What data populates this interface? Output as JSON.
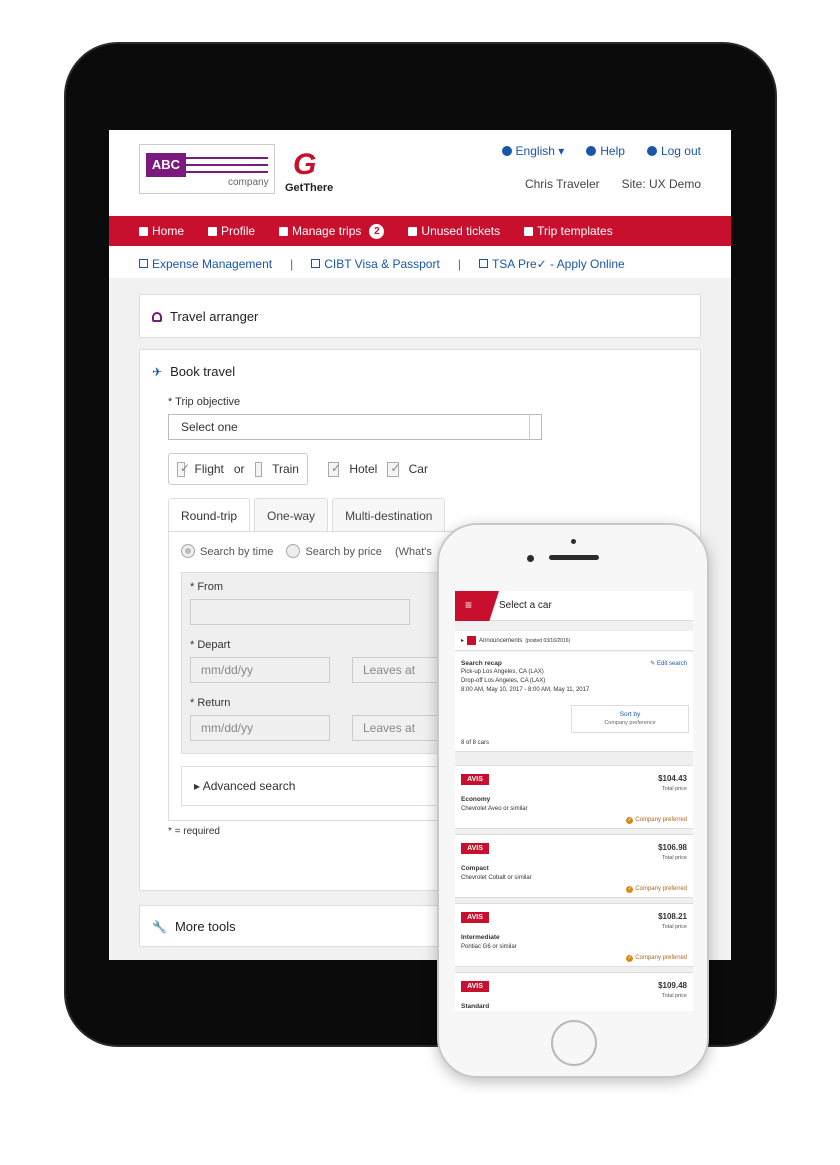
{
  "tablet": {
    "header": {
      "logo_abc": "ABC",
      "logo_company": "company",
      "logo_getthere_mark": "G",
      "logo_getthere": "GetThere",
      "language": "English",
      "help": "Help",
      "logout": "Log out",
      "user_name": "Chris Traveler",
      "site": "Site: UX Demo"
    },
    "nav": {
      "items": [
        "Home",
        "Profile",
        "Manage trips",
        "Unused tickets",
        "Trip templates"
      ],
      "manage_trips_badge": "2"
    },
    "external_links": [
      "Expense Management",
      "CIBT Visa & Passport",
      "TSA Pre✓ - Apply Online"
    ],
    "travel_arranger": "Travel arranger",
    "book_travel": {
      "title": "Book travel",
      "trip_objective_label": "* Trip objective",
      "trip_objective_value": "Select one",
      "modes": {
        "flight": "Flight",
        "or": "or",
        "train": "Train",
        "hotel": "Hotel",
        "car": "Car"
      },
      "tabs": [
        "Round-trip",
        "One-way",
        "Multi-destination"
      ],
      "search_by_time": "Search by time",
      "search_by_price": "Search by price",
      "whats": "(What's",
      "from_label": "* From",
      "depart_label": "* Depart",
      "return_label": "* Return",
      "date_placeholder": "mm/dd/yy",
      "leaves_at": "Leaves at",
      "advanced_search": "Advanced search",
      "required_note": "* = required"
    },
    "more_tools": "More tools"
  },
  "phone": {
    "title": "Select a car",
    "announcements": "Announcements",
    "announcements_posted": "(posted 03/16/2016)",
    "recap": {
      "title": "Search recap",
      "edit": "Edit search",
      "pickup": "Pick-up Los Angeles, CA (LAX)",
      "dropoff": "Drop-off Los Angeles, CA (LAX)",
      "dates": "8:00 AM, May 10, 2017 - 8:00 AM, May 11, 2017"
    },
    "sort_by": "Sort by",
    "sort_value": "Company preference",
    "count": "8 of 8 cars",
    "cars": [
      {
        "vendor": "AVIS",
        "price": "$104.43",
        "price_label": "Total price",
        "class": "Economy",
        "model": "Chevrolet Aveo or similar",
        "preferred": "Company preferred"
      },
      {
        "vendor": "AVIS",
        "price": "$106.98",
        "price_label": "Total price",
        "class": "Compact",
        "model": "Chevrolet Cobalt or similar",
        "preferred": "Company preferred"
      },
      {
        "vendor": "AVIS",
        "price": "$108.21",
        "price_label": "Total price",
        "class": "Intermediate",
        "model": "Pontiac G6 or similar",
        "preferred": "Company preferred"
      },
      {
        "vendor": "AVIS",
        "price": "$109.48",
        "price_label": "Total price",
        "class": "Standard",
        "model": "",
        "preferred": ""
      }
    ]
  },
  "colors": {
    "brand_red": "#c8102e",
    "link_blue": "#1a56a8",
    "abc_purple": "#7a1a7e"
  }
}
